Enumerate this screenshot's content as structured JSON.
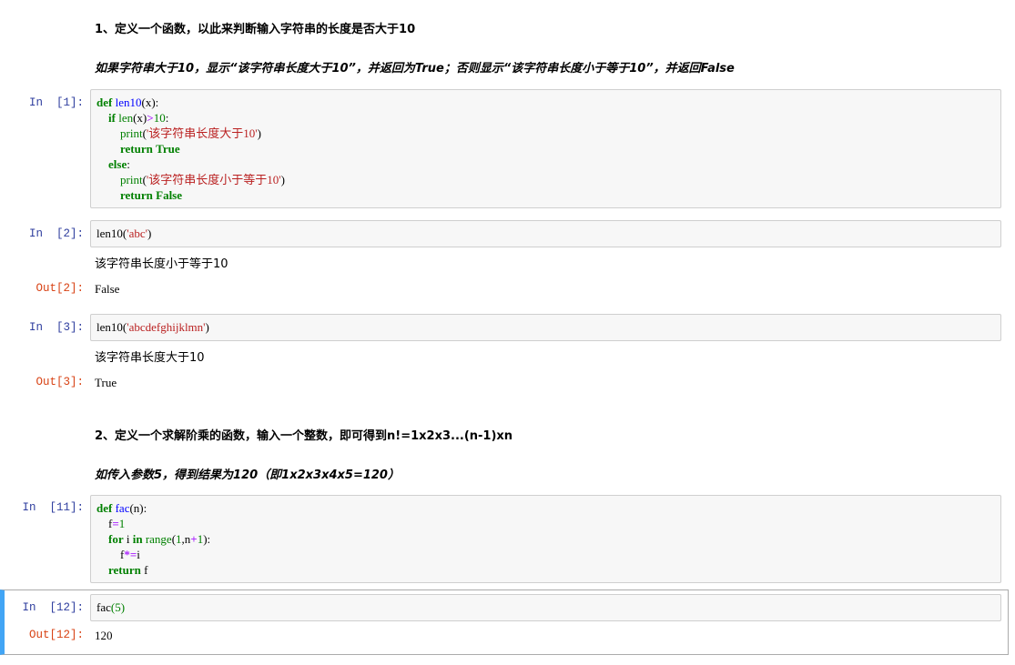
{
  "markdown": {
    "heading1": "1、定义一个函数，以此来判断输入字符串的长度是否大于10",
    "desc1": "如果字符串大于10，显示“该字符串长度大于10”，并返回为True；否则显示“该字符串长度小于等于10”，并返回False",
    "heading2": "2、定义一个求解阶乘的函数，输入一个整数，即可得到n!=1x2x3...(n-1)xn",
    "desc2": "如传入参数5，得到结果为120（即1x2x3x4x5=120）"
  },
  "cells": {
    "c1": {
      "prompt": "In  [1]:",
      "code": {
        "def": "def",
        "name": "len10",
        "sig": "(x):",
        "if": "if",
        "len": "len",
        "cond_rest": "(x)",
        "gt": ">",
        "ten": "10",
        "colon": ":",
        "print1": "print",
        "str1": "'该字符串长度大于10'",
        "return1": "return",
        "true": "True",
        "else": "else",
        "print2": "print",
        "str2": "'该字符串长度小于等于10'",
        "return2": "return",
        "false": "False"
      }
    },
    "c2": {
      "prompt": "In  [2]:",
      "call": "len10",
      "arg": "'abc'",
      "stdout": "该字符串长度小于等于10",
      "out_prompt": "Out[2]:",
      "result": "False"
    },
    "c3": {
      "prompt": "In  [3]:",
      "call": "len10",
      "arg": "'abcdefghijklmn'",
      "stdout": "该字符串长度大于10",
      "out_prompt": "Out[3]:",
      "result": "True"
    },
    "c11": {
      "prompt": "In  [11]:",
      "code": {
        "def": "def",
        "name": "fac",
        "sig": "(n):",
        "f": "f",
        "eq": "=",
        "one": "1",
        "for": "for",
        "i": "i",
        "in": "in",
        "range": "range",
        "range_open": "(",
        "r1": "1",
        "comma_n": ",n",
        "plus": "+",
        "r2": "1",
        "range_close": "):",
        "f2": "f",
        "muleq": "*=",
        "i2": "i",
        "return": "return",
        "ret_val": "f"
      }
    },
    "c12": {
      "prompt": "In  [12]:",
      "call": "fac",
      "open": "(",
      "arg": "5",
      "close": ")",
      "out_prompt": "Out[12]:",
      "result": "120"
    }
  },
  "colors": {
    "keyword": "#008000",
    "function": "#0000ff",
    "string": "#ba2121",
    "operator": "#aa22ff",
    "in_prompt": "#303f9f",
    "out_prompt": "#d84315",
    "selected_border": "#42a5f5"
  }
}
